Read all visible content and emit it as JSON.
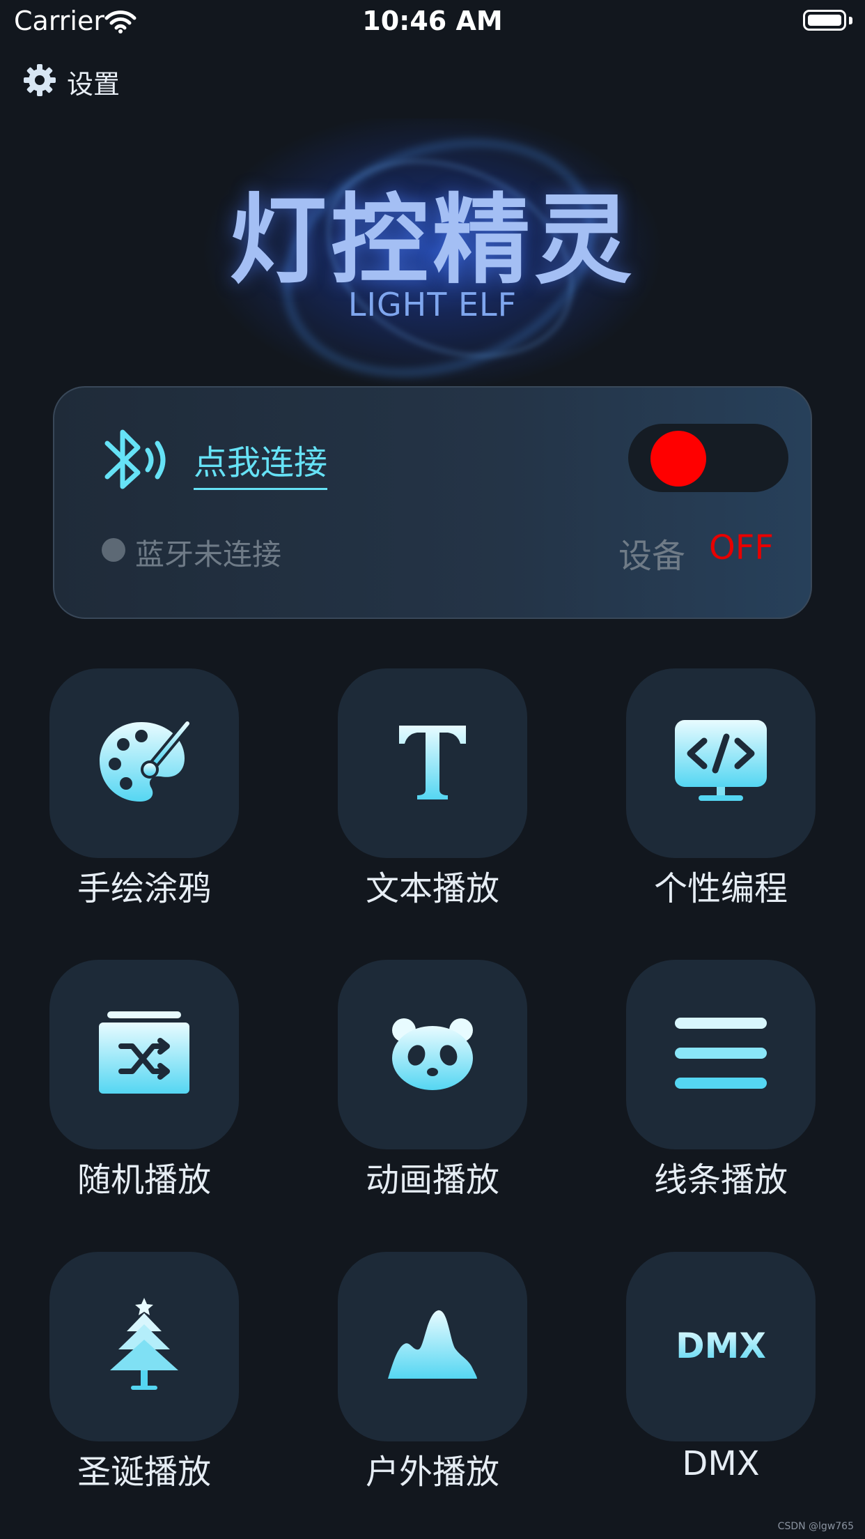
{
  "status_bar": {
    "carrier": "Carrier",
    "time": "10:46 AM"
  },
  "settings": {
    "label": "设置",
    "icon": "gear-icon"
  },
  "header": {
    "title": "灯控精灵",
    "subtitle": "LIGHT ELF"
  },
  "connection": {
    "connect_label": "点我连接",
    "bluetooth_status": "蓝牙未连接",
    "device_label": "设备",
    "device_state": "OFF",
    "toggle_on": false
  },
  "modes": [
    {
      "label": "手绘涂鸦",
      "icon": "palette-icon"
    },
    {
      "label": "文本播放",
      "icon": "text-icon"
    },
    {
      "label": "个性编程",
      "icon": "code-monitor-icon"
    },
    {
      "label": "随机播放",
      "icon": "shuffle-icon"
    },
    {
      "label": "动画播放",
      "icon": "panda-icon"
    },
    {
      "label": "线条播放",
      "icon": "lines-icon"
    },
    {
      "label": "圣诞播放",
      "icon": "christmas-tree-icon"
    },
    {
      "label": "户外播放",
      "icon": "mountain-icon"
    },
    {
      "label": "DMX",
      "icon": "dmx-icon"
    }
  ],
  "watermark": "CSDN @lgw765",
  "colors": {
    "accent": "#66e2f6",
    "background": "#12171e",
    "tile": "#1d2a38",
    "off_state": "#e80000",
    "toggle_knob": "#ff0000"
  }
}
